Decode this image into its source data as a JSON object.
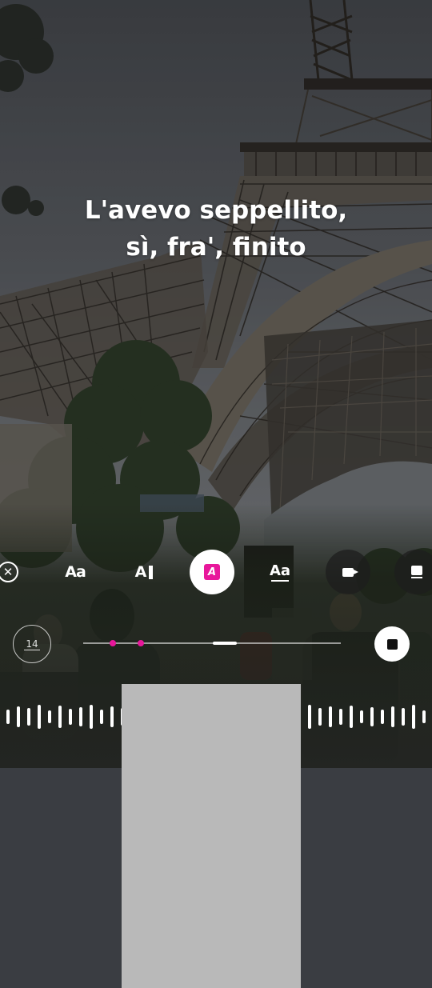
{
  "lyrics": {
    "line1": "L'avevo seppellito,",
    "line2": "sì, fra', finito"
  },
  "toolbar": {
    "close_icon": "close-icon",
    "text_style_label": "Aa",
    "align_label": "A",
    "highlight_label": "A",
    "font_label": "Aa",
    "accent_color": "#e8179b"
  },
  "timeline": {
    "count_label": "14",
    "stop_icon": "stop-icon"
  }
}
